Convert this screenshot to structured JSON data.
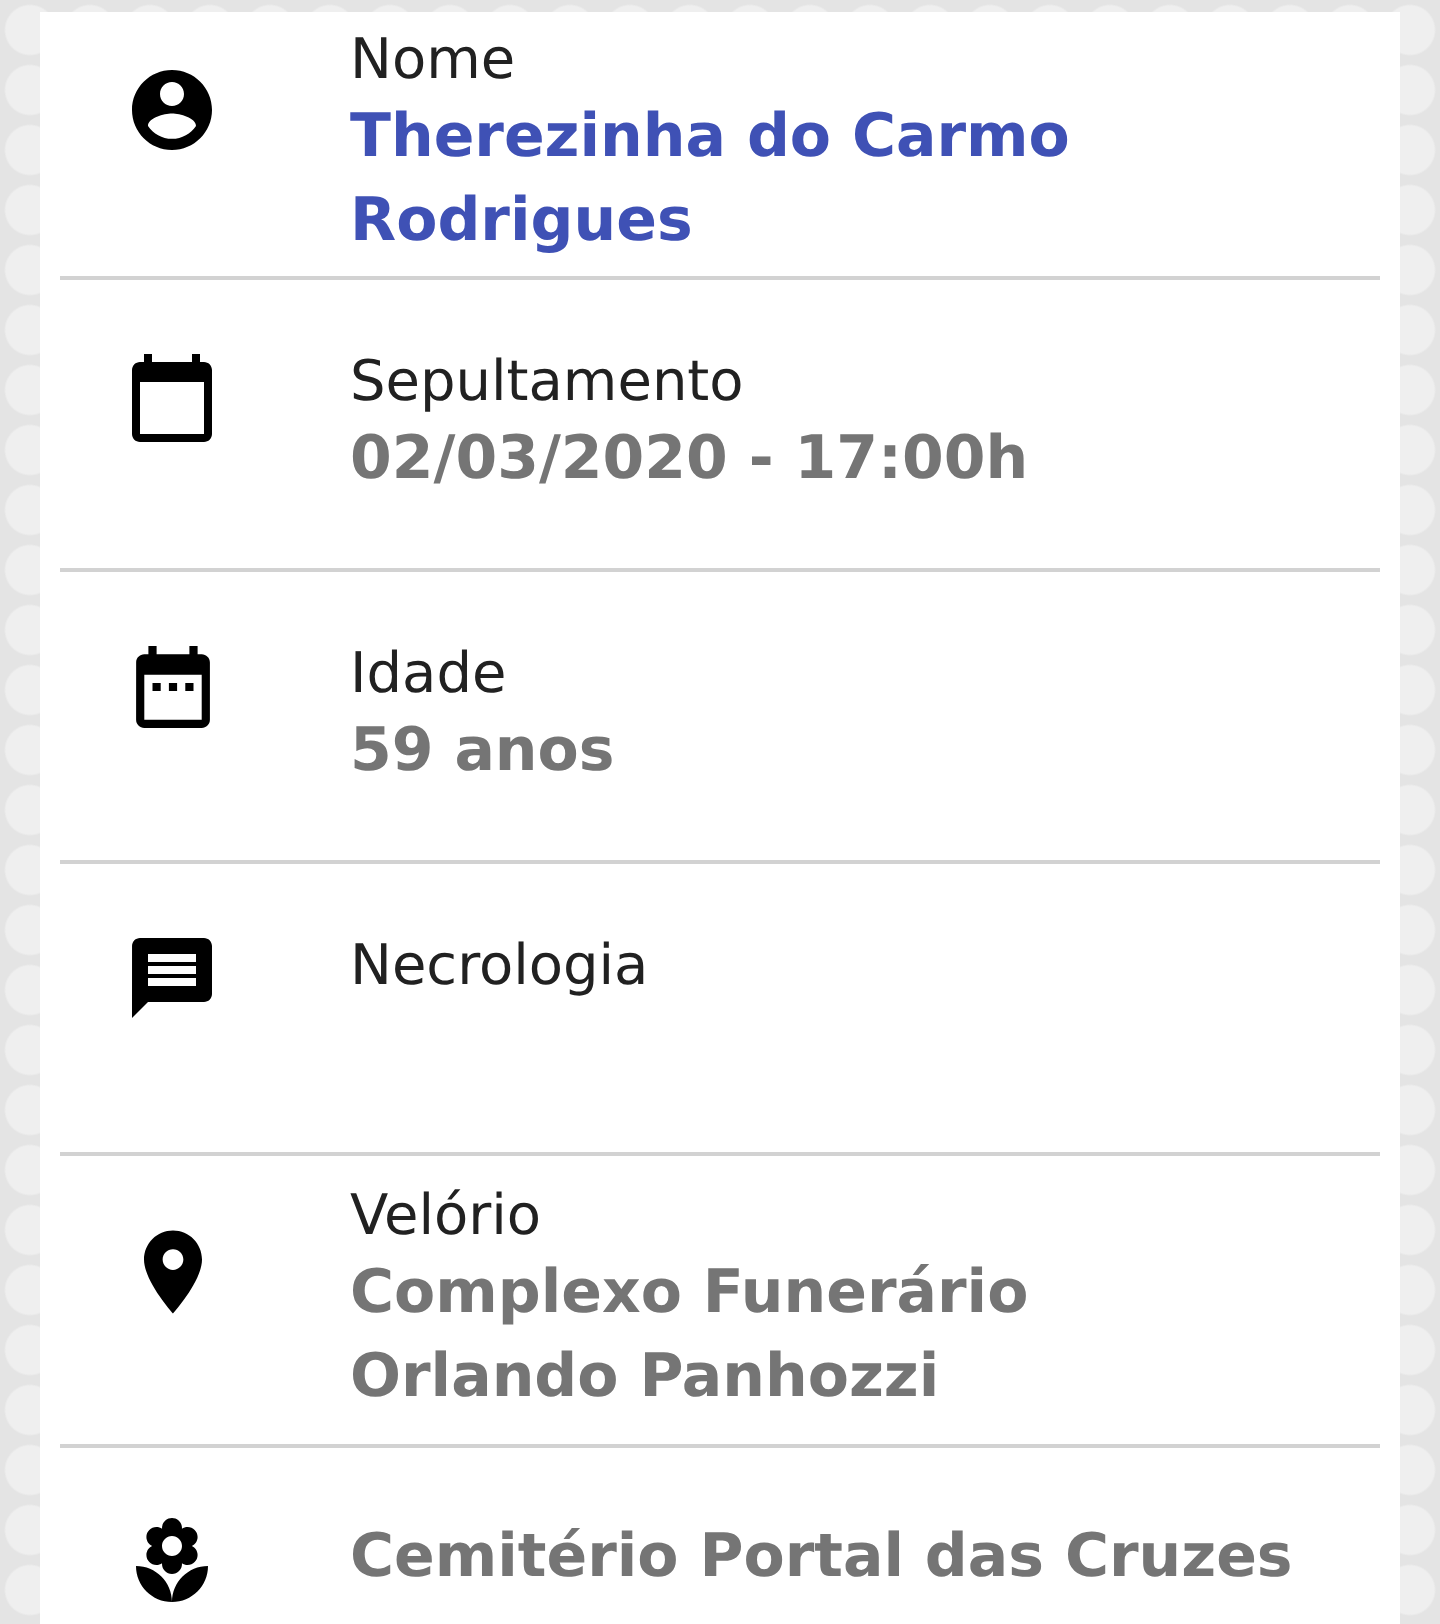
{
  "details": [
    {
      "kind": "person",
      "label": "Nome",
      "value": "Therezinha do Carmo Rodrigues"
    },
    {
      "kind": "burial",
      "label": "Sepultamento",
      "value": "02/03/2020 - 17:00h"
    },
    {
      "kind": "age",
      "label": "Idade",
      "value": "59 anos"
    },
    {
      "kind": "obituary",
      "label": "Necrologia"
    },
    {
      "kind": "wake",
      "label": "Velório",
      "value": "Complexo Funerário Orlando Panhozzi"
    },
    {
      "kind": "cemetery",
      "value": "Cemitério Portal das Cruzes"
    }
  ]
}
